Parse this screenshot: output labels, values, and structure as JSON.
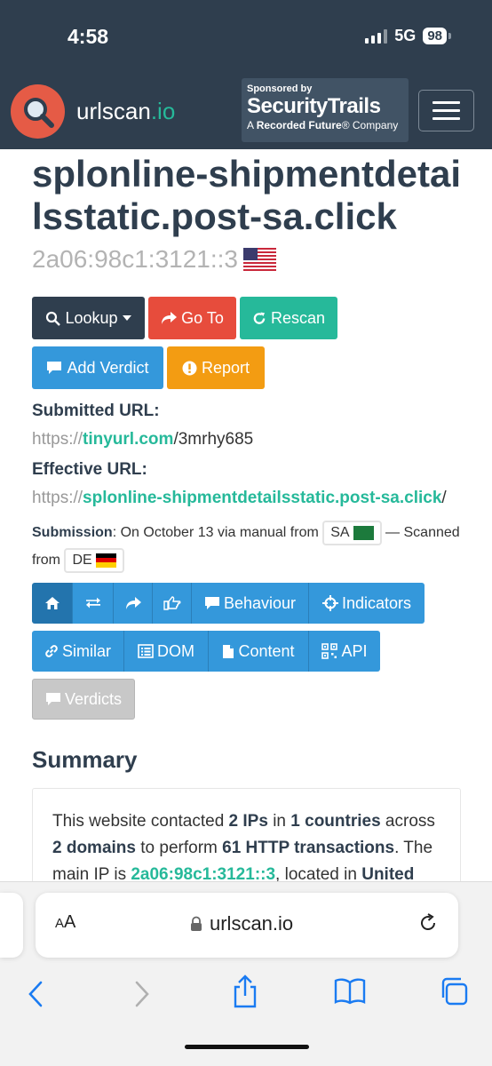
{
  "status": {
    "time": "4:58",
    "network": "5G",
    "battery": "98"
  },
  "header": {
    "brand_name": "urlscan",
    "brand_tld": ".io",
    "sponsor_by": "Sponsored by",
    "sponsor_name": "SecurityTrails",
    "sponsor_tagline_prefix": "A",
    "sponsor_tagline_bold": "Recorded Future",
    "sponsor_tagline_suffix": "® Company"
  },
  "page": {
    "title": "splonline-shipmentdetailsstatic.post-sa.click",
    "ip": "2a06:98c1:3121::3"
  },
  "actions": {
    "lookup": "Lookup",
    "goto": "Go To",
    "rescan": "Rescan",
    "verdict": "Add Verdict",
    "report": "Report"
  },
  "submitted": {
    "label": "Submitted URL",
    "scheme": "https://",
    "host": "tinyurl.com",
    "path": "/3mrhy685"
  },
  "effective": {
    "label": "Effective URL",
    "scheme": "https://",
    "host": "splonline-shipmentdetailsstatic.post-sa.click",
    "path": "/"
  },
  "submission": {
    "label": "Submission",
    "text": ": On October 13 via manual from",
    "from_cc": "SA",
    "dash": "—",
    "scanned_text": "Scanned from",
    "scanned_cc": "DE"
  },
  "tabs": {
    "behaviour": "Behaviour",
    "indicators": "Indicators",
    "similar": "Similar",
    "dom": "DOM",
    "content": "Content",
    "api": "API",
    "verdicts": "Verdicts"
  },
  "summary": {
    "heading": "Summary",
    "t1": "This website contacted ",
    "ips": "2 IPs",
    "t2": " in ",
    "countries": "1 countries",
    "t3": " across ",
    "domains": "2 domains",
    "t4": " to perform ",
    "transactions": "61 HTTP transactions",
    "t5": ". The main IP is ",
    "main_ip": "2a06:98c1:3121::3",
    "t6": ", located in ",
    "country": "United States"
  },
  "safari": {
    "aa_small": "A",
    "aa_large": "A",
    "url": "urlscan.io"
  },
  "colors": {
    "header": "#2f3e4e",
    "accent": "#26b99a",
    "red": "#e74c3c",
    "blue": "#3498db",
    "orange": "#f39c12"
  }
}
